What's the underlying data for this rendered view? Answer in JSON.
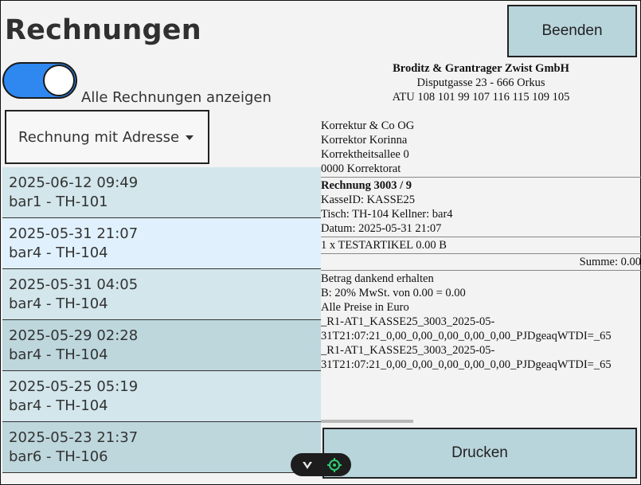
{
  "header": {
    "title": "Rechnungen",
    "end_button": "Beenden"
  },
  "filter": {
    "toggle_on": true,
    "toggle_label": "Alle Rechnungen anzeigen",
    "dropdown_value": "Rechnung mit Adresse"
  },
  "colors": {
    "accent": "#2f88f0",
    "button_bg": "#b9d5dc",
    "row_a": "#d2e6eb",
    "row_b": "#bdd7dd",
    "row_selected": "#e0f1fd"
  },
  "invoices": [
    {
      "datetime": "2025-06-12 09:49",
      "detail": "bar1 - TH-101"
    },
    {
      "datetime": "2025-05-31 21:07",
      "detail": "bar4 - TH-104"
    },
    {
      "datetime": "2025-05-31 04:05",
      "detail": "bar4 - TH-104"
    },
    {
      "datetime": "2025-05-29 02:28",
      "detail": "bar4 - TH-104"
    },
    {
      "datetime": "2025-05-25 05:19",
      "detail": "bar4 - TH-104"
    },
    {
      "datetime": "2025-05-23 21:37",
      "detail": "bar6 - TH-106"
    }
  ],
  "receipt": {
    "company": "Broditz & Grantrager Zwist GmbH",
    "street": "Disputgasse 23 - 666 Orkus",
    "atu": "ATU 108 101 99 107 116 115 109 105",
    "customer": [
      "Korrektur & Co OG",
      "Korrektor Korinna",
      "Korrektheitsallee 0",
      "0000 Korrektorat"
    ],
    "invoice_no": "Rechnung 3003 / 9",
    "info": [
      "KasseID: KASSE25",
      "Tisch: TH-104 Kellner: bar4",
      "Datum: 2025-05-31 21:07"
    ],
    "item": "1 x TESTARTIKEL 0.00 B",
    "sum": "Summe: 0.00",
    "footer": [
      "Betrag dankend erhalten",
      "B: 20% MwSt. von 0.00 = 0.00",
      "Alle Preise in Euro"
    ],
    "codes": [
      "_R1-AT1_KASSE25_3003_2025-05-",
      "31T21:07:21_0,00_0,00_0,00_0,00_0,00_PJDgeaqWTDI=_65",
      "_R1-AT1_KASSE25_3003_2025-05-",
      "31T21:07:21_0,00_0,00_0,00_0,00_0,00_PJDgeaqWTDI=_65"
    ]
  },
  "print_button": "Drucken"
}
